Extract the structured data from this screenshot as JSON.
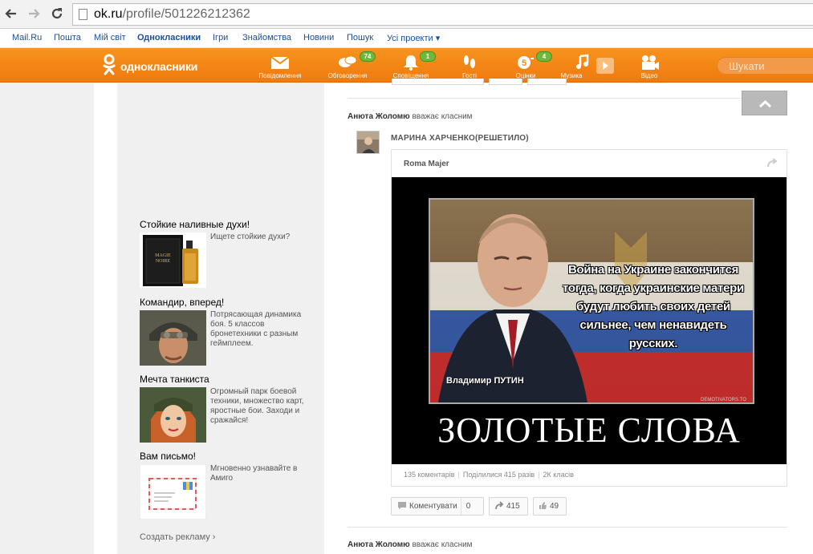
{
  "browser": {
    "url_host": "ok.ru",
    "url_path": "/profile/501226212362"
  },
  "portal": {
    "links": [
      "Mail.Ru",
      "Пошта",
      "Мій світ",
      "Однокласники",
      "Ігри",
      "Знайомства",
      "Новини",
      "Пошук",
      "Усі проекти ▾"
    ]
  },
  "okbar": {
    "logo": "однокласники",
    "nav": [
      {
        "label": "Повідомлення",
        "icon": "envelope-icon"
      },
      {
        "label": "Обговорення",
        "icon": "chat-bubbles-icon",
        "badge": "74"
      },
      {
        "label": "Сповіщення",
        "icon": "bell-icon",
        "badge": "1"
      },
      {
        "label": "Гості",
        "icon": "footprints-icon"
      },
      {
        "label": "Оцінки",
        "icon": "ratings-icon",
        "badge": "4"
      },
      {
        "label": "Музика",
        "icon": "music-note-icon"
      },
      {
        "label": "Відео",
        "icon": "video-camera-icon"
      }
    ],
    "search_placeholder": "Шукати"
  },
  "ads": [
    {
      "title": "Стойкие наливные духи!",
      "desc": "Ищете стойкие духи?"
    },
    {
      "title": "Командир, вперед!",
      "desc": "Потрясающая динамика боя. 5 классов бронетехники с разным геймплеем."
    },
    {
      "title": "Мечта танкиста",
      "desc": "Огромный парк боевой техники, множество карт, яростные бои. Заходи и сражайся!"
    },
    {
      "title": "Вам письмо!",
      "desc": "Мгновенно узнавайте в Амиго"
    }
  ],
  "create_ad": "Создать рекламу ›",
  "feed": {
    "item1": {
      "actor": "Анюта Жоломю",
      "action": "вважає класним",
      "author": "МАРИНА ХАРЧЕНКО(РЕШЕТИЛО)",
      "source": "Roma Majer",
      "poster": {
        "quote": "Война на Украине закончится тогда, когда украинские матери будут любить своих детей сильнее, чем ненавидеть русских.",
        "signature": "Владимир ПУТИН",
        "watermark": "DEMOTIVATORS.TO",
        "caption": "ЗОЛОТЫЕ СЛОВА"
      },
      "stats": {
        "comments": "135 коментарів",
        "shares": "Поділилися 415 разів",
        "classes": "2К класів"
      },
      "actions": {
        "comment_label": "Коментувати",
        "comment_count": "0",
        "share_count": "415",
        "like_count": "49"
      }
    },
    "item2": {
      "actor": "Анюта Жоломю",
      "action": "вважає класним"
    }
  },
  "colors": {
    "ok_orange": "#f7931e",
    "badge_green": "#6fb83c",
    "link_blue": "#1a4f9c"
  }
}
